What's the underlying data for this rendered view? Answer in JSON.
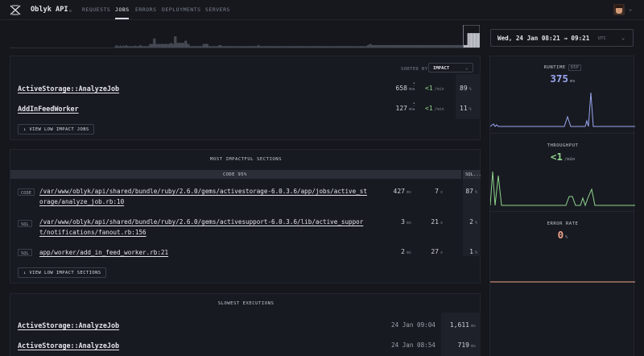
{
  "header": {
    "app_name": "Oblyk API",
    "nav": [
      {
        "label": "REQUESTS",
        "active": false
      },
      {
        "label": "JOBS",
        "active": true
      },
      {
        "label": "ERRORS",
        "active": false
      },
      {
        "label": "DEPLOYMENTS",
        "active": false
      },
      {
        "label": "SERVERS",
        "active": false
      }
    ],
    "logo_icon": "x-logo-icon",
    "avatar_icon": "avatar"
  },
  "timeline": {
    "bars": [
      0,
      0,
      0,
      0,
      0,
      0,
      0,
      0,
      0,
      0,
      0,
      0,
      0,
      0,
      0,
      0,
      0,
      0,
      0,
      0,
      0,
      0,
      0,
      0,
      0,
      0,
      0,
      0,
      0,
      0,
      0,
      0,
      0,
      0,
      0,
      0,
      0,
      0,
      0,
      0,
      0,
      0,
      0,
      0,
      0,
      0,
      0,
      0,
      0,
      0,
      0,
      0,
      0,
      0,
      0,
      0,
      0,
      0,
      0,
      0,
      0,
      0,
      0,
      0,
      0,
      0,
      0,
      0,
      0,
      0,
      0,
      0,
      0,
      0,
      0,
      0,
      0,
      0,
      0,
      0,
      0,
      0,
      0,
      0,
      0,
      0,
      0,
      0,
      0,
      0,
      0,
      0,
      0,
      0,
      0,
      0,
      0,
      0,
      0,
      0,
      0,
      0,
      0,
      0,
      0,
      0,
      0,
      0,
      0,
      0,
      0,
      0,
      0,
      0,
      0,
      0,
      0,
      0,
      0,
      0,
      0,
      0,
      0,
      0,
      0,
      0,
      0,
      0,
      0,
      0,
      0,
      0,
      0,
      0,
      0,
      0,
      0,
      0,
      0,
      0,
      0,
      0,
      0,
      0,
      0,
      0,
      0,
      0,
      0,
      0,
      0,
      0,
      0,
      0,
      0,
      0,
      0,
      0,
      0,
      0,
      0,
      0.1,
      0.1,
      0.15,
      0.15,
      0.1,
      0.1,
      0.1,
      0.1,
      0.15,
      0.1,
      0.1,
      0.1,
      0.1,
      0.15,
      0.1,
      0.1,
      0.1,
      0.15,
      0.15,
      0.1,
      0.1,
      0.1,
      0.1,
      0.1,
      0.1,
      0.1,
      0.1,
      0.1,
      0.1,
      0.1,
      0.1,
      0.15,
      0.1,
      0.1,
      0.1,
      0.1,
      0.1,
      0.1,
      0.15,
      0.15,
      0.15,
      0.1,
      0.1,
      0.1,
      0.1,
      0.1,
      0.1,
      0.1,
      0.1,
      0.1,
      0.1,
      0.1,
      0.1,
      0.2,
      0.2,
      0.2,
      0.2,
      0.2,
      0.2,
      0.45,
      0.45,
      0.45,
      0.45,
      0.2,
      0.2,
      0.2,
      0.2,
      0.2,
      0.2,
      0.2,
      0.2,
      0.2,
      0.2,
      0.2,
      0.2,
      0.2,
      0.2,
      0.2,
      0.2,
      0.2,
      0.2,
      0.2,
      0.2,
      0.2,
      0.2,
      0.25,
      0.25,
      0.25,
      0.2,
      0.2,
      0.2,
      0.55,
      0.55,
      0.55,
      0.55,
      0.25,
      0.25,
      0.25,
      0.25,
      0.25,
      0.25,
      0.25,
      0.25,
      0.25,
      0.25,
      0.25,
      0.25,
      0.35,
      0.35,
      0.35,
      0.35,
      0.2,
      0.2,
      0.2,
      0.2,
      0.1,
      0.1,
      0.1,
      0.1,
      0.1,
      0.1,
      0.1,
      0.1,
      0.1,
      0.1,
      0.1,
      0.1,
      0.1,
      0.1,
      0.1,
      0.1,
      0.1,
      0.1,
      0.1,
      0.1,
      0.2,
      0.2,
      0.2,
      0.2,
      0.2,
      0.2,
      0.2,
      0.2,
      0.2,
      0.1,
      0.1,
      0.1,
      0.1,
      0.1,
      0.1,
      0.1,
      0.1,
      0.1,
      0.1,
      0.1,
      0.1,
      0.1,
      0.1,
      0.1,
      0.15,
      0.15,
      0.15,
      0.15,
      0.15,
      0.1,
      0.1,
      0.1,
      0.1,
      0.1,
      0.1,
      0.1,
      0.1,
      0.1,
      0.1,
      0.1,
      0.1,
      0.1,
      0.1,
      0.1,
      0.1,
      0.1,
      0.1,
      0.1,
      0.1,
      0.1,
      0.1,
      0.1,
      0.1,
      0.1,
      0.1,
      0.1,
      0.1,
      0.1,
      0.1,
      0.1,
      0.1,
      0.1,
      0.1,
      0.1,
      0.1,
      0.1,
      0.1,
      0.1,
      0.1,
      0.1,
      0.1,
      0.1,
      0.1,
      0.1,
      0.1,
      0.1,
      0.1,
      0.1,
      0.1,
      0.1,
      0.1,
      0.1,
      0.1,
      0.1,
      0.15,
      0.15,
      0.15,
      0.1,
      0.1,
      0.1,
      0.1,
      0.1,
      0.1,
      0.1,
      0.1,
      0.1,
      0.1,
      0.1,
      0.1,
      0.1,
      0.1,
      0.1,
      0.1,
      0.1,
      0.1,
      0.1,
      0.1,
      0.1,
      0.1,
      0.1,
      0.1,
      0.1,
      0.1,
      0.1,
      0.1,
      0.1,
      0.1,
      0.1,
      0.1,
      0.1,
      0.1,
      0.1,
      0.1,
      0.1,
      0.1,
      0.1,
      0.1,
      0.1,
      0.1,
      0.1,
      0.1,
      0.1,
      0.1,
      0.1,
      0.1,
      0.1,
      0.1,
      0.1,
      0.1,
      0.1,
      0.1,
      0.1,
      0.1,
      0.1,
      0.1,
      0.1,
      0.1,
      0.1,
      0.1,
      0.1,
      0.1,
      0.1,
      0.1,
      0.1,
      0.1,
      0.1,
      0.1,
      0.1,
      0.1,
      0.1,
      0.1,
      0.1,
      0.1,
      0.1,
      0.1,
      0.1,
      0.1,
      0.1,
      0.1,
      0.1,
      0.1,
      0.1,
      0.1,
      0.1,
      0.1,
      0.1,
      0.1,
      0.1,
      0.1,
      0.1,
      0.1,
      0.1,
      0.1,
      0.1,
      0.1,
      0.1,
      0.1,
      0.1,
      0.1,
      0.1,
      0.1,
      0.1,
      0.1,
      0.1,
      0.1,
      0.1,
      0.1,
      0.1,
      0.1,
      0.1,
      0.1,
      0.1,
      0.1,
      0.1,
      0.1,
      0.1,
      0.1,
      0.1,
      0.1,
      0.1,
      0.1,
      0.1,
      0.1,
      0.1,
      0.1,
      0.1,
      0.1,
      0.1,
      0.1,
      0.1,
      0.1,
      0.1,
      0.1,
      0.1,
      0.1,
      0.1,
      0.1,
      0.1,
      0.1,
      0.1,
      0.1,
      0.1,
      0.1,
      0.1,
      0.1,
      0.1,
      0.1,
      0.1,
      0.1,
      0.1,
      0.1,
      0.1,
      0.1,
      0.1,
      0.1,
      0.1,
      0.1,
      0.1,
      0.1,
      0.1,
      0.1,
      0.1,
      0.15,
      0.15,
      0.15,
      0.2,
      0.2,
      0.2,
      0.2,
      0.15,
      0.15,
      0.15,
      0.15,
      0.15,
      0.15,
      0.15,
      0.15,
      0.15,
      0.15,
      0.15,
      0.15,
      0.15,
      0.15,
      0.15,
      0.15,
      0.15,
      0.15,
      0.15,
      0.15,
      0.15,
      0.15,
      0.15,
      0.15,
      0.15,
      0.15,
      0.15,
      0.15,
      0.15,
      0.15,
      0.15,
      0.15,
      0.15,
      0.15,
      0.15,
      0.15,
      0.15,
      0.15,
      0.15,
      0.15,
      0.15,
      0.15,
      0.15,
      0.15,
      0.15,
      0.15,
      0.15,
      0.15,
      0.15,
      0.15,
      0.15,
      0.15,
      0.15,
      0.15,
      0.15,
      0.15,
      0.15,
      0.15,
      0.15,
      0.15,
      0.15,
      0.15,
      0.15,
      0.15,
      0.15,
      0.15,
      0.15,
      0.15,
      0.15,
      0.15,
      0.15,
      0.15,
      0.15,
      0.15,
      0.15,
      0.15,
      0.15,
      0.15,
      0.15,
      0.15,
      0.15,
      0.15,
      0.15,
      0.15,
      0.15,
      0.15,
      0.15,
      0.15,
      0.15,
      0.15,
      0.15,
      0.15,
      0.15,
      0.15,
      0.15,
      0.15,
      0.15,
      0.15,
      0.15,
      0.15,
      0.15,
      0.15,
      0.15,
      0.15,
      0.15,
      0.15,
      0.15,
      0.15,
      0.15,
      0.15,
      0.15,
      0.15,
      0.15,
      0.15,
      0.15,
      0.15,
      0.15,
      0.15,
      0.15,
      0.15,
      0.15,
      0.15,
      0.15,
      0.15,
      0.15,
      0.15,
      0.15,
      0.15,
      0.15,
      0.15,
      0.15,
      0.15,
      0.15,
      0.15,
      0.15,
      0.15,
      0.15,
      0.15,
      0.15,
      0.15,
      0.15,
      0.15,
      0.15,
      0.15,
      0.15,
      0.15,
      0.15,
      0.7,
      0.7,
      0.7,
      0.7,
      0.7,
      0.7,
      0.7,
      0.7,
      0.7,
      0.7,
      0.7,
      0.7,
      0.7,
      0.7,
      0.7,
      0.7,
      0.7,
      0.7,
      0.7
    ],
    "selected_range": [
      0.965,
      1.0
    ]
  },
  "date_picker": {
    "label": "Wed, 24 Jan 08:21 → 09:21",
    "tz": "UTC"
  },
  "jobs": {
    "sort_label": "SORTED BY",
    "sort_value": "IMPACT",
    "rows": [
      {
        "name": "ActiveStorage::AnalyzeJob",
        "time": "658",
        "time_unit": "ms",
        "throughput": "<1",
        "throughput_unit": "/min",
        "impact": "89",
        "impact_unit": "%"
      },
      {
        "name": "AddInFeedWorker",
        "time": "127",
        "time_unit": "ms",
        "throughput": "<1",
        "throughput_unit": "/min",
        "impact": "11",
        "impact_unit": "%"
      }
    ],
    "low_impact_button": "↓ VIEW LOW IMPACT JOBS"
  },
  "sections": {
    "title": "MOST IMPACTFUL SECTIONS",
    "code_bar_label": "CODE 95%",
    "sql_bar_label": "SQL...",
    "rows": [
      {
        "tag": "CODE",
        "path_line1": "/var/www/oblyk/api/shared/bundle/ruby/2.6.0/gems/activestorage-6.0.3.6/app/jobs/active_st",
        "path_line2": "orage/analyze_job.rb",
        "line": ":10",
        "time": "427",
        "time_unit": "ms",
        "count": "7",
        "count_unit": "x",
        "pct": "87",
        "pct_unit": "%"
      },
      {
        "tag": "SQL",
        "path_line1": "/var/www/oblyk/api/shared/bundle/ruby/2.6.0/gems/activesupport-6.0.3.6/lib/active_suppor",
        "path_line2": "t/notifications/fanout.rb",
        "line": ":156",
        "time": "3",
        "time_unit": "ms",
        "count": "21",
        "count_unit": "x",
        "pct": "2",
        "pct_unit": "%"
      },
      {
        "tag": "SQL",
        "path_line1": "app/worker/add_in_feed_worker.rb",
        "path_line2": "",
        "line": ":21",
        "time": "2",
        "time_unit": "ms",
        "count": "27",
        "count_unit": "x",
        "pct": "1",
        "pct_unit": "%"
      }
    ],
    "low_impact_button": "↓ VIEW LOW IMPACT SECTIONS"
  },
  "slowest": {
    "title": "SLOWEST EXECUTIONS",
    "rows": [
      {
        "name": "ActiveStorage::AnalyzeJob",
        "date": "24 Jan 09:04",
        "duration": "1,611",
        "unit": "ms"
      },
      {
        "name": "ActiveStorage::AnalyzeJob",
        "date": "24 Jan 08:54",
        "duration": "719",
        "unit": "ms"
      }
    ]
  },
  "metrics": {
    "runtime": {
      "title": "RUNTIME",
      "badge": "95P",
      "value": "375",
      "unit": "ms",
      "color": "#9aa7f0"
    },
    "throughput": {
      "title": "THROUGHPUT",
      "value": "<1",
      "unit": "/min",
      "color": "#8fd48c"
    },
    "error_rate": {
      "title": "ERROR RATE",
      "value": "0",
      "unit": "%",
      "color": "#f0a58c"
    }
  }
}
